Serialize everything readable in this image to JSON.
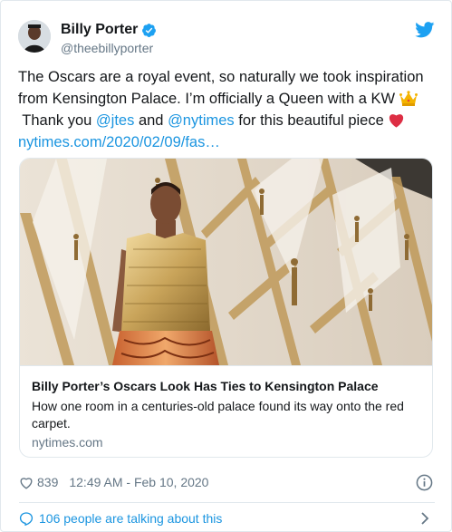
{
  "author": {
    "display_name": "Billy Porter",
    "handle": "@theebillyporter",
    "verified": true
  },
  "tweet": {
    "line1": "The Oscars are a royal event, so naturally we took inspiration",
    "line2_text": "from Kensington Palace. I’m officially a Queen with a KW",
    "line3_pre": " Thank you ",
    "mention1": "@jtes",
    "line3_mid": " and ",
    "mention2": "@nytimes",
    "line3_post": " for this beautiful piece",
    "link": "nytimes.com/2020/02/09/fas…",
    "emoji_crown": "crown-emoji",
    "emoji_heart": "red-heart-emoji"
  },
  "card": {
    "title": "Billy Porter’s Oscars Look Has Ties to Kensington Palace",
    "description": "How one room in a centuries-old palace found its way onto the red carpet.",
    "domain": "nytimes.com"
  },
  "footer": {
    "like_count": "839",
    "timestamp": "12:49 AM - Feb 10, 2020",
    "talking": "106 people are talking about this"
  },
  "colors": {
    "link": "#1b95e0",
    "verified": "#1da1f2",
    "secondary": "#657786",
    "heart_emoji": "#dd2e44",
    "crown_emoji": "#f4b400"
  }
}
